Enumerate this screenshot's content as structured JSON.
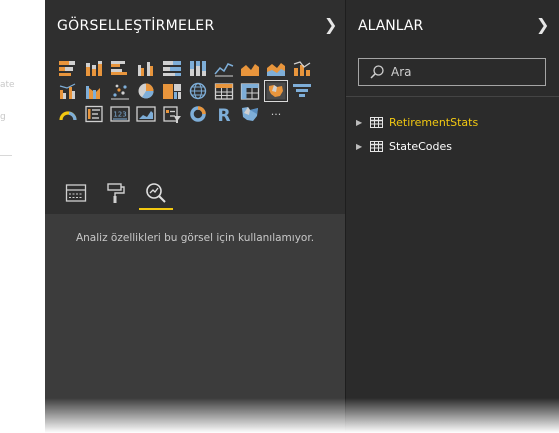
{
  "left_fragments": [
    "ate",
    "g"
  ],
  "visualizations": {
    "title": "GÖRSELLEŞTİRMELER",
    "collapse_icon": "chevron-right-icon",
    "gallery": [
      {
        "name": "stacked-bar-chart-icon"
      },
      {
        "name": "stacked-column-chart-icon"
      },
      {
        "name": "clustered-bar-chart-icon"
      },
      {
        "name": "clustered-column-chart-icon"
      },
      {
        "name": "100-stacked-bar-chart-icon"
      },
      {
        "name": "100-stacked-column-chart-icon"
      },
      {
        "name": "line-chart-icon"
      },
      {
        "name": "area-chart-icon"
      },
      {
        "name": "stacked-area-chart-icon"
      },
      {
        "name": "line-stacked-column-chart-icon"
      },
      {
        "name": "line-clustered-column-chart-icon"
      },
      {
        "name": "ribbon-chart-icon"
      },
      {
        "name": "scatter-chart-icon"
      },
      {
        "name": "pie-chart-icon"
      },
      {
        "name": "treemap-icon"
      },
      {
        "name": "globe-map-icon"
      },
      {
        "name": "table-icon"
      },
      {
        "name": "matrix-icon"
      },
      {
        "name": "filled-map-icon",
        "selected": true
      },
      {
        "name": "funnel-chart-icon"
      },
      {
        "name": "gauge-icon"
      },
      {
        "name": "multi-row-card-icon"
      },
      {
        "name": "card-icon",
        "text": "123"
      },
      {
        "name": "kpi-icon"
      },
      {
        "name": "slicer-icon"
      },
      {
        "name": "donut-chart-icon"
      },
      {
        "name": "r-visual-icon",
        "text": "R"
      },
      {
        "name": "shape-map-icon"
      },
      {
        "name": "more-visuals-icon",
        "text": "···"
      }
    ],
    "tabs": [
      {
        "name": "fields-tab",
        "icon": "fields-well-icon"
      },
      {
        "name": "format-tab",
        "icon": "paint-roller-icon"
      },
      {
        "name": "analytics-tab",
        "icon": "analytics-magnifier-icon",
        "active": true
      }
    ],
    "analytics_message": "Analiz özellikleri bu görsel için kullanılamıyor."
  },
  "fields": {
    "title": "ALANLAR",
    "collapse_icon": "chevron-right-icon",
    "search_placeholder": "Ara",
    "tables": [
      {
        "label": "RetirementStats",
        "highlighted": true
      },
      {
        "label": "StateCodes",
        "highlighted": false
      }
    ]
  },
  "colors": {
    "panel_bg": "#2f2f2f",
    "accent_yellow": "#f2c811",
    "icon_orange": "#e8953c",
    "icon_blue": "#7eaed8",
    "icon_gray": "#d0d0d0"
  }
}
